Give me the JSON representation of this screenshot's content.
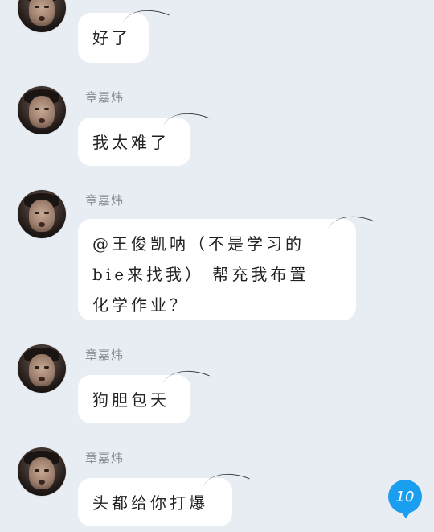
{
  "messages": [
    {
      "sender": "",
      "text": "好了"
    },
    {
      "sender": "章嘉炜",
      "text": "我太难了"
    },
    {
      "sender": "章嘉炜",
      "lines": [
        "@王俊凯呐（不是学习的",
        "bie来找我）  帮充我布置",
        "化学作业？"
      ]
    },
    {
      "sender": "章嘉炜",
      "text": "狗胆包天"
    },
    {
      "sender": "章嘉炜",
      "text": "头都给你打爆"
    }
  ],
  "unread_count": "10",
  "colors": {
    "background": "#e8edf3",
    "bubble": "#ffffff",
    "unread_badge": "#1a9ef0"
  }
}
